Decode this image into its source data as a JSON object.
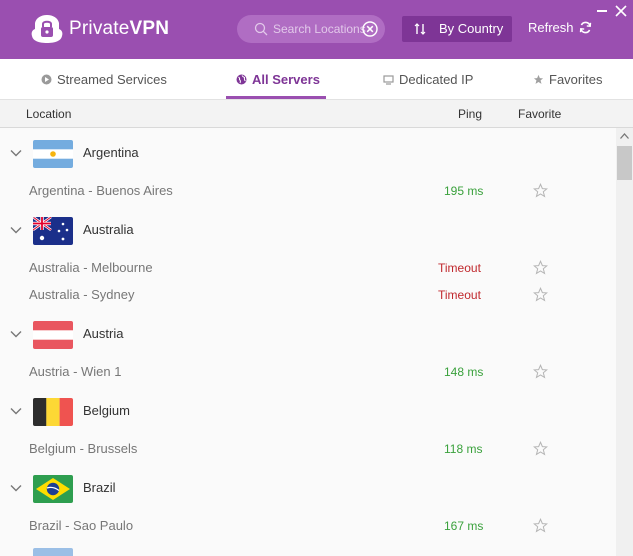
{
  "app": {
    "brand_first": "Private",
    "brand_second": "VPN"
  },
  "header": {
    "search_placeholder": "Search Locations",
    "sort_label": "By Country",
    "refresh_label": "Refresh"
  },
  "tabs": [
    {
      "label": "Streamed Services",
      "icon": "play-icon"
    },
    {
      "label": "All Servers",
      "icon": "globe-icon",
      "active": true
    },
    {
      "label": "Dedicated IP",
      "icon": "monitor-icon"
    },
    {
      "label": "Favorites",
      "icon": "star-icon"
    }
  ],
  "columns": {
    "location": "Location",
    "ping": "Ping",
    "favorite": "Favorite"
  },
  "countries": [
    {
      "name": "Argentina",
      "flag": "argentina",
      "servers": [
        {
          "name": "Argentina - Buenos Aires",
          "ping": "195 ms",
          "status": "ok"
        }
      ]
    },
    {
      "name": "Australia",
      "flag": "australia",
      "servers": [
        {
          "name": "Australia - Melbourne",
          "ping": "Timeout",
          "status": "timeout"
        },
        {
          "name": "Australia - Sydney",
          "ping": "Timeout",
          "status": "timeout"
        }
      ]
    },
    {
      "name": "Austria",
      "flag": "austria",
      "servers": [
        {
          "name": "Austria - Wien 1",
          "ping": "148 ms",
          "status": "ok"
        }
      ]
    },
    {
      "name": "Belgium",
      "flag": "belgium",
      "servers": [
        {
          "name": "Belgium - Brussels",
          "ping": "118 ms",
          "status": "ok"
        }
      ]
    },
    {
      "name": "Brazil",
      "flag": "brazil",
      "servers": [
        {
          "name": "Brazil - Sao Paulo",
          "ping": "167 ms",
          "status": "ok"
        }
      ]
    }
  ],
  "colors": {
    "header_bg": "#9a4fb0",
    "accent": "#7e3596",
    "ping_ok": "#3aa13c",
    "ping_timeout": "#c0282d"
  }
}
